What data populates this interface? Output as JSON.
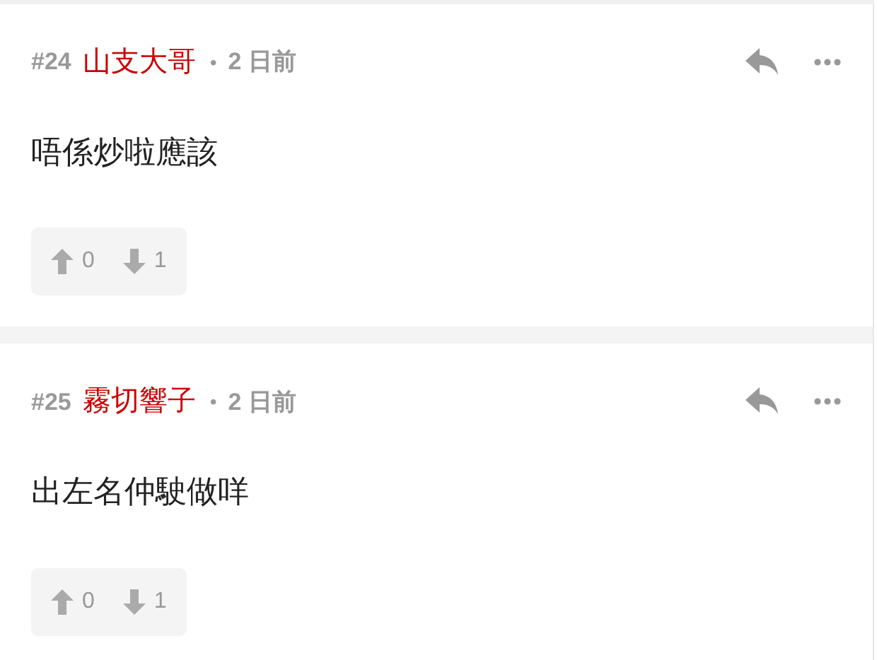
{
  "comments": [
    {
      "number": "#24",
      "author": "山支大哥",
      "bullet": "•",
      "time": "2 日前",
      "text": "唔係炒啦應該",
      "upvotes": "0",
      "downvotes": "1"
    },
    {
      "number": "#25",
      "author": "霧切響子",
      "bullet": "•",
      "time": "2 日前",
      "text": "出左名仲駛做咩",
      "upvotes": "0",
      "downvotes": "1"
    }
  ]
}
